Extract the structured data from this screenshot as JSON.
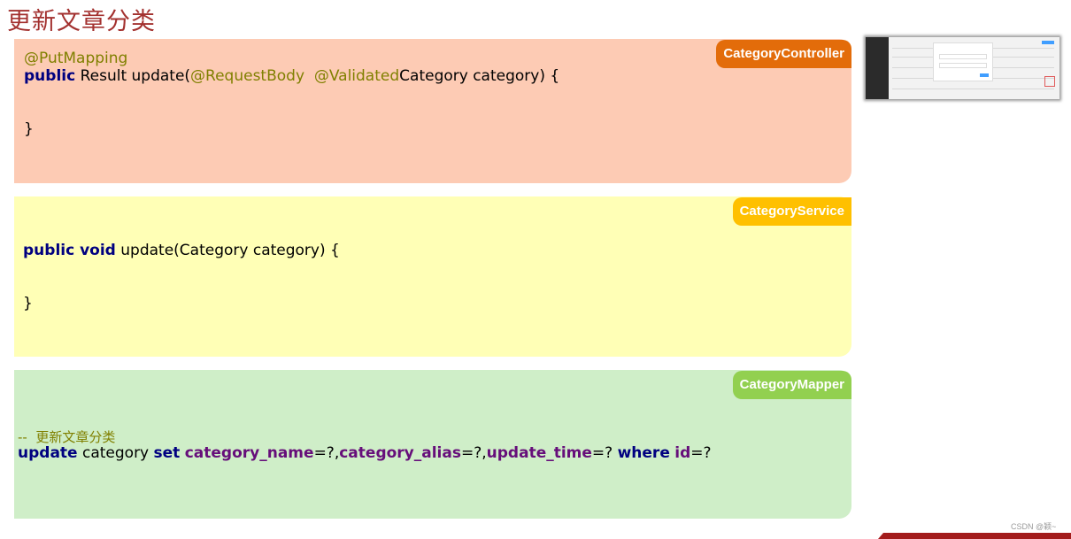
{
  "title": "更新文章分类",
  "controller": {
    "tag": "CategoryController",
    "annotation": "@PutMapping",
    "line1_kw": "public",
    "line1_a": " Result update(",
    "line1_ann1": "@RequestBody",
    "line1_sp": "  ",
    "line1_ann2": "@Validated",
    "line1_b": "Category category) {",
    "close": "}"
  },
  "service": {
    "tag": "CategoryService",
    "kw": "public void",
    "sig": " update(Category category) {",
    "close": "}"
  },
  "mapper": {
    "tag": "CategoryMapper",
    "comment": "--  更新文章分类",
    "kw_update": "update",
    "t1": " category ",
    "kw_set": "set",
    "sp1": " ",
    "f1": "category_name",
    "t2": "=?,",
    "f2": "category_alias",
    "t3": "=?,",
    "f3": "update_time",
    "t4": "=? ",
    "kw_where": "where",
    "sp2": " ",
    "f4": "id",
    "t5": "=?"
  },
  "watermark": "CSDN @颖~",
  "colors": {
    "controller_bg": "#fdcbb4",
    "service_bg": "#ffffb6",
    "mapper_bg": "#cfeec8",
    "title": "#a3312f"
  }
}
